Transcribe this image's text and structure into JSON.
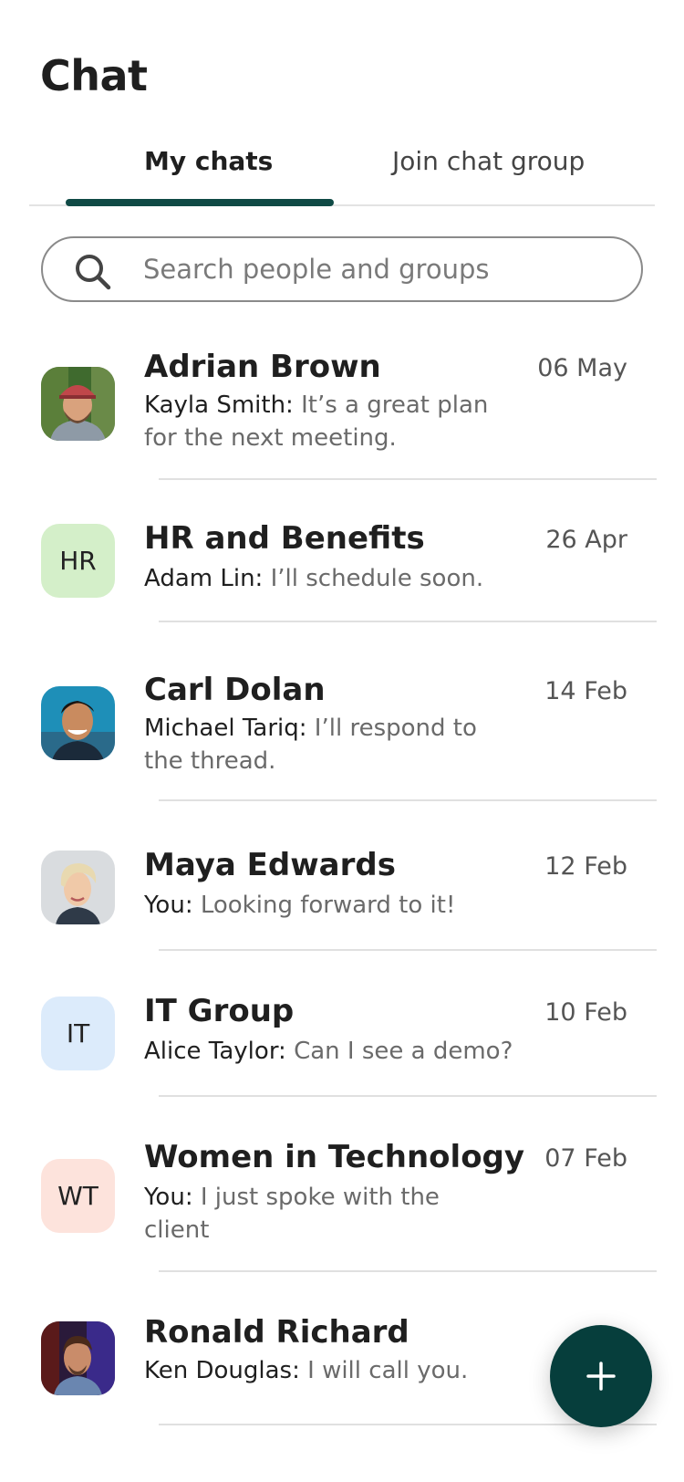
{
  "header": {
    "title": "Chat"
  },
  "tabs": [
    {
      "label": "My chats",
      "active": true
    },
    {
      "label": "Join chat group",
      "active": false
    }
  ],
  "search": {
    "placeholder": "Search people and groups",
    "icon": "search-icon"
  },
  "chats": [
    {
      "name": "Adrian Brown",
      "date": "06 May",
      "sender": "Kayla Smith:",
      "message": " It’s a great plan for the next meeting.",
      "avatar": {
        "type": "photo",
        "description": "man with red cap"
      }
    },
    {
      "name": "HR and Benefits",
      "date": "26 Apr",
      "sender": "Adam Lin:",
      "message": " I’ll schedule soon.",
      "avatar": {
        "type": "initials",
        "initials": "HR",
        "color": "#d4efc9"
      }
    },
    {
      "name": "Carl Dolan",
      "date": "14 Feb",
      "sender": "Michael Tariq:",
      "message": " I’ll respond to the thread.",
      "avatar": {
        "type": "photo",
        "description": "smiling man blue background"
      }
    },
    {
      "name": "Maya Edwards",
      "date": "12 Feb",
      "sender": "You:",
      "message": " Looking forward to it!",
      "avatar": {
        "type": "photo",
        "description": "woman short blonde hair"
      }
    },
    {
      "name": "IT Group",
      "date": "10 Feb",
      "sender": "Alice Taylor:",
      "message": " Can I see a demo?",
      "avatar": {
        "type": "initials",
        "initials": "IT",
        "color": "#dcebfb"
      }
    },
    {
      "name": "Women in Technology",
      "date": "07 Feb",
      "sender": "You:",
      "message": " I just spoke with the client",
      "avatar": {
        "type": "initials",
        "initials": "WT",
        "color": "#fde3dc"
      }
    },
    {
      "name": "Ronald Richard",
      "date": "",
      "sender": "Ken Douglas:",
      "message": " I will call you.",
      "avatar": {
        "type": "photo",
        "description": "man dark background"
      }
    }
  ],
  "fab": {
    "icon": "plus-icon",
    "color": "#063e3c"
  },
  "colors": {
    "accent": "#0f4a45"
  }
}
